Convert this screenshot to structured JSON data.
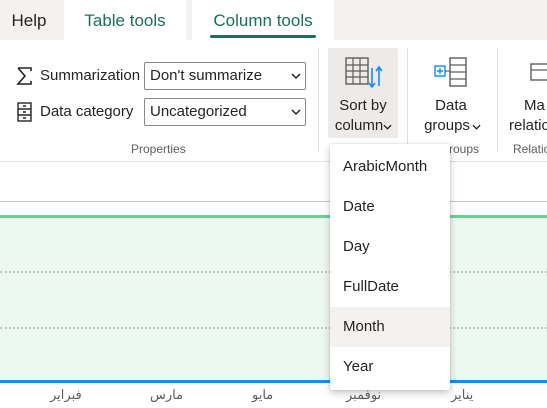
{
  "tabs": {
    "help": "Help",
    "table_tools": "Table tools",
    "column_tools": "Column tools"
  },
  "properties": {
    "summarization_label": "Summarization",
    "summarization_value": "Don't summarize",
    "category_label": "Data category",
    "category_value": "Uncategorized",
    "group_label": "Properties"
  },
  "sort": {
    "line1": "Sort by",
    "line2": "column"
  },
  "groups": {
    "line1": "Data",
    "line2": "groups",
    "group_label": "roups"
  },
  "relationships": {
    "line1": "Ma",
    "line2": "relatio",
    "group_label": "Relatio"
  },
  "sort_menu": {
    "items": [
      "ArabicMonth",
      "Date",
      "Day",
      "FullDate",
      "Month",
      "Year"
    ],
    "hovered": "Month"
  },
  "chart": {
    "x_ticks": [
      "فبراير",
      "مارس",
      "مايو",
      "نوفمبر",
      "يناير"
    ]
  },
  "colors": {
    "accent": "#1b6f58",
    "area_fill": "#ebf9f1",
    "area_line": "#6fcf97",
    "axis_line": "#118dff"
  },
  "icons": {
    "summarization": "sigma-icon",
    "category": "data-category-icon",
    "sort": "sort-by-column-icon",
    "groups": "data-groups-icon",
    "relationships": "manage-relationships-icon"
  }
}
